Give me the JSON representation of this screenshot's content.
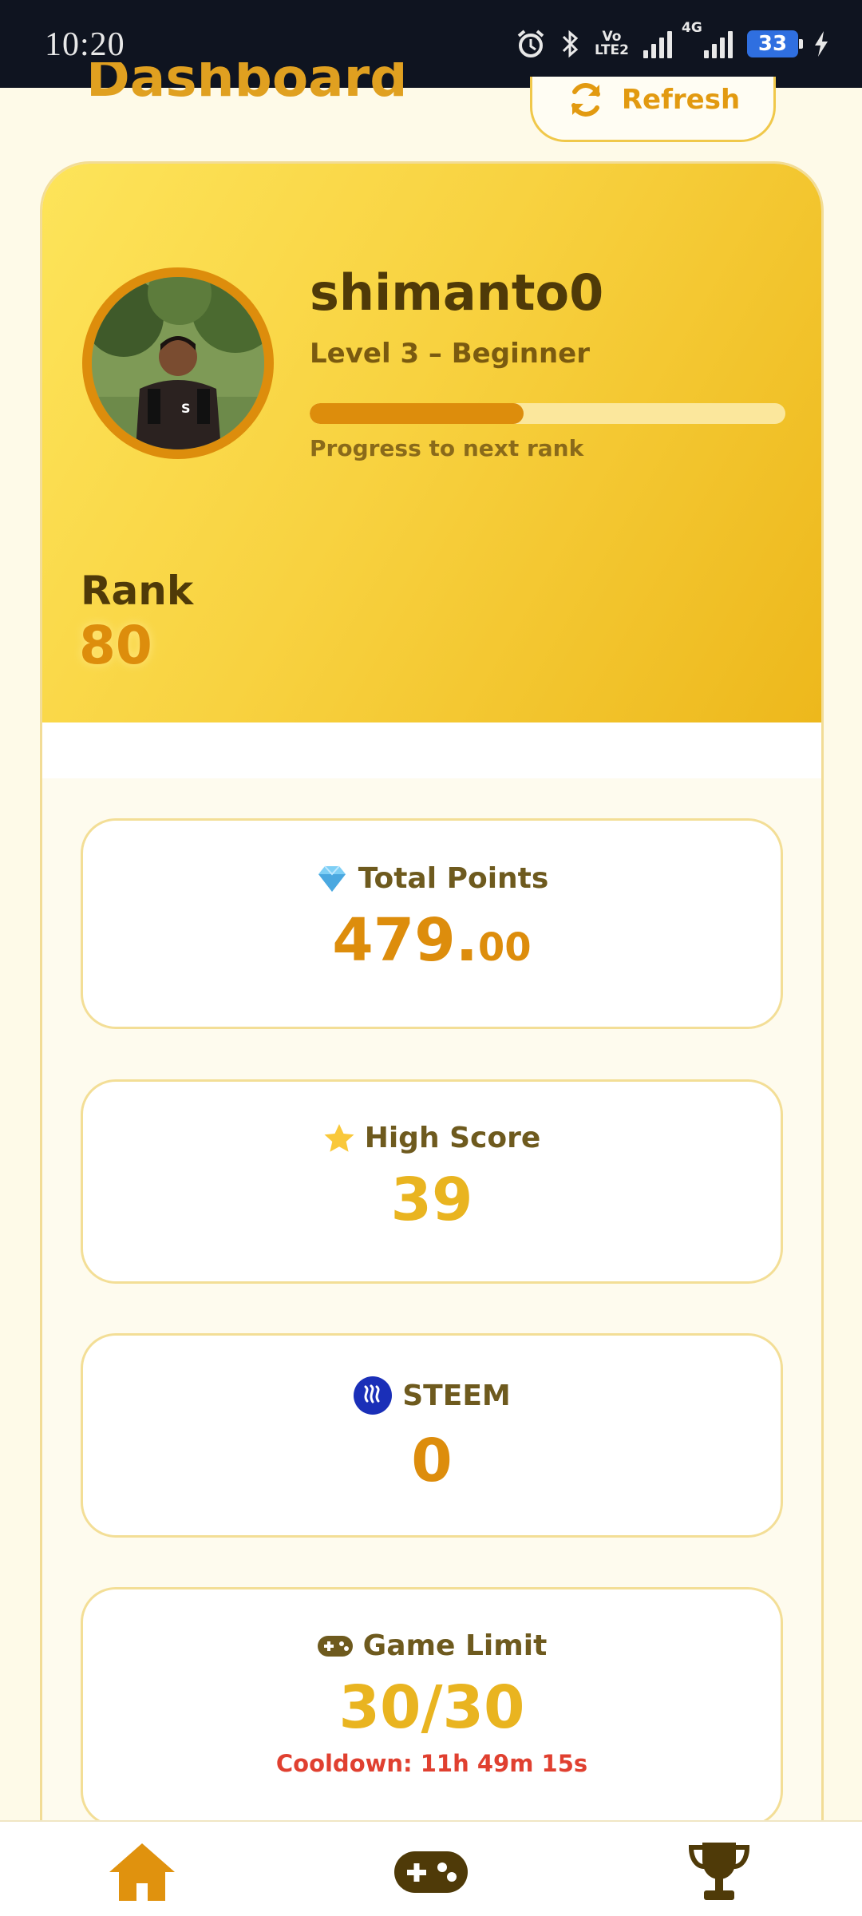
{
  "status_bar": {
    "time": "10:20",
    "network_top": "Vo",
    "network_bottom": "LTE2",
    "net_type": "4G",
    "battery": "33"
  },
  "header": {
    "title": "Dashboard",
    "refresh_label": "Refresh"
  },
  "profile": {
    "username": "shimanto0",
    "level": "Level 3 – Beginner",
    "progress_fraction": 0.45,
    "progress_label": "Progress to next rank",
    "rank_label": "Rank",
    "rank_value": "80"
  },
  "stats": {
    "total_points": {
      "icon": "gem-icon",
      "label": "Total Points",
      "value_int": "479.",
      "value_dec": "00"
    },
    "high_score": {
      "icon": "star-icon",
      "label": "High Score",
      "value": "39"
    },
    "steem": {
      "icon": "steem-icon",
      "label": "STEEM",
      "value": "0"
    },
    "game_limit": {
      "icon": "gamepad-icon",
      "label": "Game Limit",
      "value": "30/30",
      "cooldown": "Cooldown: 11h 49m 15s"
    }
  },
  "bottom_nav": [
    {
      "icon": "home-icon"
    },
    {
      "icon": "gamepad-icon"
    },
    {
      "icon": "trophy-icon"
    }
  ],
  "colors": {
    "accent": "#dd8d0c",
    "gold": "#e9b420",
    "hero_start": "#fde45a",
    "hero_end": "#edb81c",
    "danger": "#e04030"
  }
}
